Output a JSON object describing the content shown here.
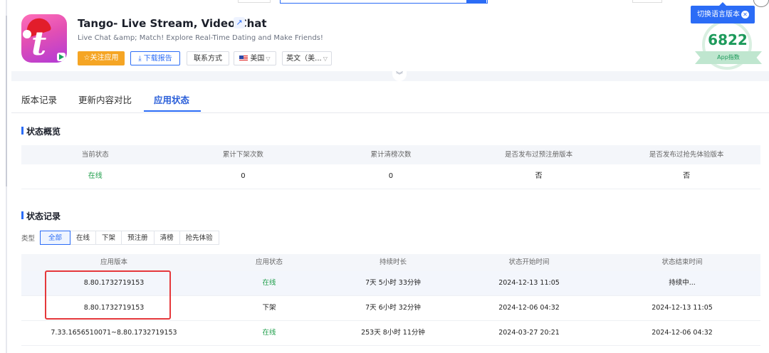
{
  "app": {
    "title": "Tango- Live Stream, Video Chat",
    "description": "Live Chat &amp; Match! Explore Real-Time Dating and Make Friends!",
    "icon_glyph": "t"
  },
  "actions": {
    "follow": "☆关注应用",
    "report": "⤓ 下载报告",
    "contact": "联系方式",
    "country": "美国",
    "language": "英文（美..."
  },
  "lang_switch": {
    "label": "切换语言版本",
    "close": "✕"
  },
  "score": {
    "value": "6822",
    "label": "App指数"
  },
  "tabs": [
    {
      "label": "版本记录"
    },
    {
      "label": "更新内容对比"
    },
    {
      "label": "应用状态"
    }
  ],
  "overview": {
    "title": "状态概览",
    "headers": [
      "当前状态",
      "累计下架次数",
      "累计清榜次数",
      "是否发布过预注册版本",
      "是否发布过抢先体验版本"
    ],
    "values": [
      "在线",
      "0",
      "0",
      "否",
      "否"
    ]
  },
  "records": {
    "title": "状态记录",
    "filter_label": "类型",
    "filters": [
      "全部",
      "在线",
      "下架",
      "预注册",
      "清榜",
      "抢先体验"
    ],
    "headers": [
      "应用版本",
      "应用状态",
      "持续时长",
      "状态开始时间",
      "状态结束时间"
    ],
    "rows": [
      {
        "version": "8.80.1732719153",
        "status": "在线",
        "duration": "7天 5小时 33分钟",
        "start": "2024-12-13 11:05",
        "end": "持续中..."
      },
      {
        "version": "8.80.1732719153",
        "status": "下架",
        "duration": "7天 6小时 32分钟",
        "start": "2024-12-06 04:32",
        "end": "2024-12-13 11:05"
      },
      {
        "version": "7.33.1656510071~8.80.1732719153",
        "status": "在线",
        "duration": "253天 8小时 11分钟",
        "start": "2024-03-27 20:21",
        "end": "2024-12-06 04:32"
      }
    ]
  },
  "colors": {
    "accent": "#2b6cf6",
    "online": "#1e9e4a",
    "follow": "#f5a524",
    "highlight_box": "#e5383b"
  }
}
